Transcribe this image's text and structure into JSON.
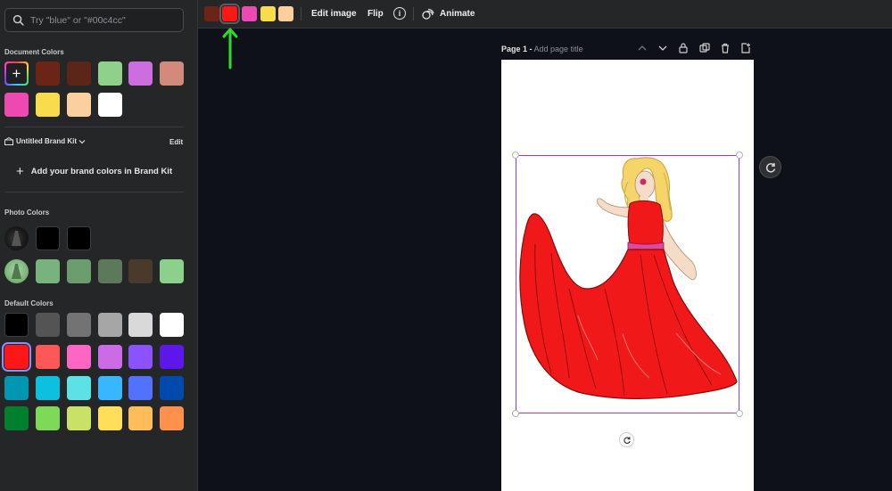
{
  "search": {
    "placeholder": "Try \"blue\" or \"#00c4cc\""
  },
  "document_colors": {
    "title": "Document Colors",
    "swatches": [
      "#6b2415",
      "#000000",
      "#5b2518",
      "#8fd18a",
      "#cc6ee0",
      "#d28a7a",
      "#ec4ab2",
      "#f9dc4c",
      "#fccf9e",
      "#ffffff"
    ]
  },
  "brand_kit": {
    "name": "Untitled Brand Kit",
    "edit_label": "Edit",
    "add_label": "Add your brand colors in Brand Kit"
  },
  "photo_colors": {
    "title": "Photo Colors",
    "row1": [
      "#000000",
      "#000000"
    ],
    "row2": [
      "#78b27c",
      "#6a9e6e",
      "#5c7a5a",
      "#4a3a2c",
      "#8dcf8c"
    ]
  },
  "default_colors": {
    "title": "Default Colors",
    "rows": [
      [
        "#000000",
        "#545454",
        "#737373",
        "#a6a6a6",
        "#d9d9d9",
        "#ffffff"
      ],
      [
        "#ff1616",
        "#ff5757",
        "#ff66c4",
        "#cb6ce6",
        "#8c52ff",
        "#5e17eb"
      ],
      [
        "#0097b2",
        "#0cc0df",
        "#5ce1e6",
        "#38b6ff",
        "#5271ff",
        "#004aad"
      ],
      [
        "#00802f",
        "#7ed957",
        "#c9e265",
        "#ffde59",
        "#ffbd59",
        "#ff914d"
      ]
    ],
    "selected": "#ff1616"
  },
  "toolbar": {
    "swatches": [
      "#6b2415",
      "#ff1616",
      "#ec4ab2",
      "#f9dc4c",
      "#fccf9e"
    ],
    "edit_image": "Edit image",
    "flip": "Flip",
    "animate": "Animate"
  },
  "page": {
    "label": "Page 1 -",
    "title_placeholder": "Add page title"
  },
  "colors": {
    "accent": "#8b3dff",
    "arrow": "#2ddb2d",
    "dress": "#f01818"
  }
}
